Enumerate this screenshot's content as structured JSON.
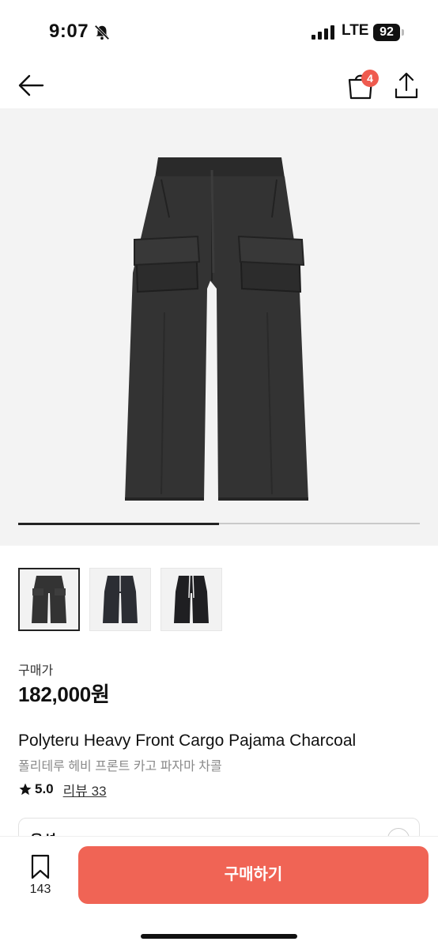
{
  "status_bar": {
    "time": "9:07",
    "network": "LTE",
    "battery": "92"
  },
  "nav": {
    "back_icon": "arrow-left-icon",
    "bag_icon": "shopping-bag-icon",
    "bag_count": "4",
    "share_icon": "share-icon"
  },
  "gallery": {
    "progress": 0.5,
    "thumbnail_count": 3,
    "selected_index": 0
  },
  "product": {
    "price_label": "구매가",
    "price": "182,000원",
    "title_en": "Polyteru Heavy Front Cargo Pajama Charcoal",
    "title_ko": "폴리테루 헤비 프론트 카고 파자마 차콜",
    "rating": "5.0",
    "review_label": "리뷰 33"
  },
  "option": {
    "label": "옵션"
  },
  "bottom_bar": {
    "wish_count": "143",
    "buy_label": "구매하기"
  },
  "colors": {
    "accent": "#f06455",
    "badge": "#ef5b4f"
  }
}
